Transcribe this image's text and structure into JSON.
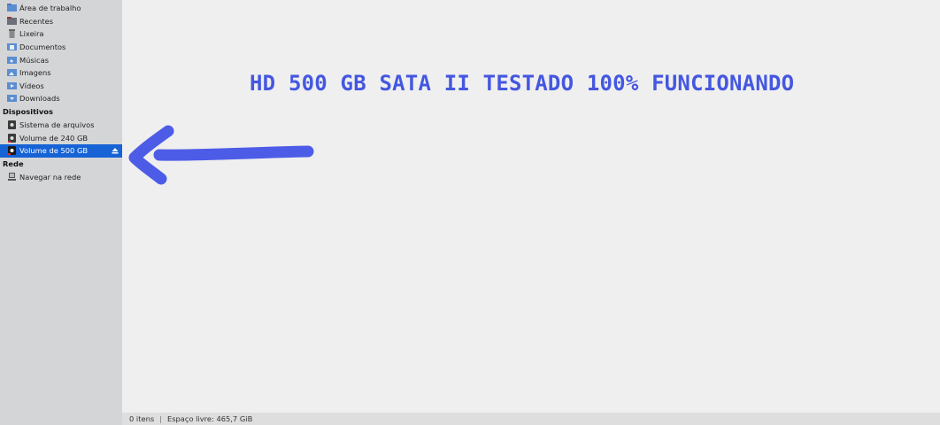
{
  "sidebar": {
    "places": [
      {
        "label": "Área de trabalho",
        "icon": "desktop-folder-icon"
      },
      {
        "label": "Recentes",
        "icon": "recent-folder-icon"
      },
      {
        "label": "Lixeira",
        "icon": "trash-icon"
      },
      {
        "label": "Documentos",
        "icon": "documents-folder-icon"
      },
      {
        "label": "Músicas",
        "icon": "music-folder-icon"
      },
      {
        "label": "Imagens",
        "icon": "pictures-folder-icon"
      },
      {
        "label": "Vídeos",
        "icon": "videos-folder-icon"
      },
      {
        "label": "Downloads",
        "icon": "downloads-folder-icon"
      }
    ],
    "devices_header": "Dispositivos",
    "devices": [
      {
        "label": "Sistema de arquivos",
        "icon": "drive-icon"
      },
      {
        "label": "Volume de 240 GB",
        "icon": "drive-icon"
      },
      {
        "label": "Volume de 500 GB",
        "icon": "drive-icon",
        "selected": true
      }
    ],
    "network_header": "Rede",
    "network": [
      {
        "label": "Navegar na rede",
        "icon": "network-icon"
      }
    ]
  },
  "main": {
    "overlay_text": "HD 500 GB SATA II TESTADO 100% FUNCIONANDO"
  },
  "statusbar": {
    "items_count": "0 itens",
    "free_space": "Espaço livre: 465,7 GiB"
  },
  "colors": {
    "selection": "#1663d6",
    "annotation": "#4457e0",
    "sidebar_bg": "#d4d5d7"
  }
}
